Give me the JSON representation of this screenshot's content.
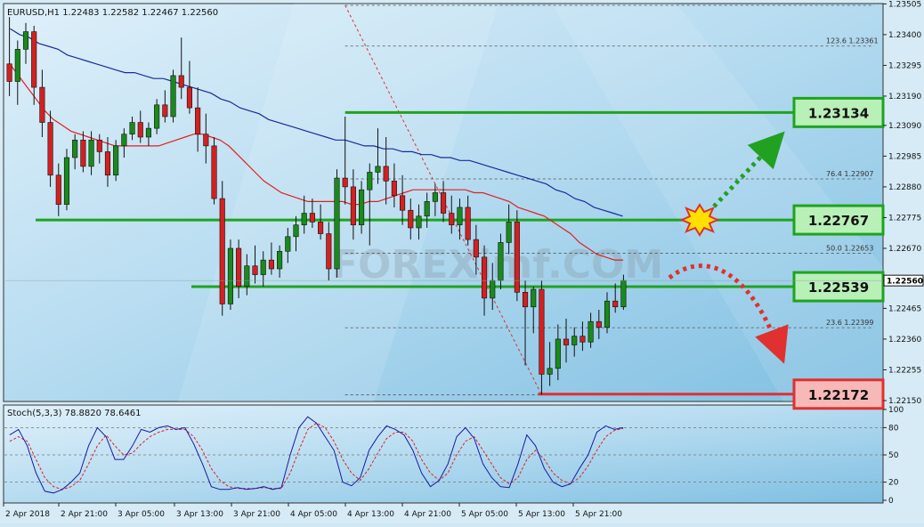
{
  "header": {
    "symbol_info": "EURUSD,H1  1.22483 1.22582 1.22467 1.22560",
    "stoch_info": "Stoch(5,3,3) 78.8820 78.6461"
  },
  "watermark": "FOREXimf.COM",
  "colors": {
    "up_candle": "#1a8a1a",
    "down_candle": "#d42020",
    "ma_fast": "#e02020",
    "ma_slow": "#1a2a9a",
    "level_line": "#1fa31f",
    "level_box_green": "#b8f0b8",
    "level_box_red": "#f7b8b8",
    "stoch_main": "#1a1aa0",
    "stoch_signal": "#e02020"
  },
  "chart_data": {
    "type": "candlestick",
    "symbol": "EURUSD",
    "timeframe": "H1",
    "ylim": [
      1.2215,
      1.235
    ],
    "y_ticks": [
      "1.23505",
      "1.23400",
      "1.23295",
      "1.23190",
      "1.23090",
      "1.22985",
      "1.22880",
      "1.22775",
      "1.22670",
      "1.22560",
      "1.22465",
      "1.22360",
      "1.22255",
      "1.22150"
    ],
    "current_price": "1.22560",
    "x_ticks": [
      "2 Apr 2018",
      "2 Apr 21:00",
      "3 Apr 05:00",
      "3 Apr 13:00",
      "3 Apr 21:00",
      "4 Apr 05:00",
      "4 Apr 13:00",
      "4 Apr 21:00",
      "5 Apr 05:00",
      "5 Apr 13:00",
      "5 Apr 21:00"
    ],
    "candles": [
      [
        1.233,
        1.2346,
        1.2319,
        1.2324
      ],
      [
        1.2324,
        1.2338,
        1.2316,
        1.2335
      ],
      [
        1.2335,
        1.2344,
        1.233,
        1.2341
      ],
      [
        1.2341,
        1.2343,
        1.2316,
        1.2322
      ],
      [
        1.2322,
        1.2328,
        1.2305,
        1.231
      ],
      [
        1.231,
        1.2314,
        1.2288,
        1.2292
      ],
      [
        1.2292,
        1.2296,
        1.2278,
        1.2282
      ],
      [
        1.2282,
        1.2301,
        1.228,
        1.2298
      ],
      [
        1.2298,
        1.2306,
        1.2294,
        1.2304
      ],
      [
        1.2304,
        1.2307,
        1.2293,
        1.2295
      ],
      [
        1.2295,
        1.2307,
        1.2292,
        1.2304
      ],
      [
        1.2304,
        1.2306,
        1.2296,
        1.23
      ],
      [
        1.23,
        1.2305,
        1.2288,
        1.2292
      ],
      [
        1.2292,
        1.2304,
        1.229,
        1.2302
      ],
      [
        1.2302,
        1.2308,
        1.2298,
        1.2306
      ],
      [
        1.2306,
        1.2312,
        1.2304,
        1.231
      ],
      [
        1.231,
        1.2314,
        1.2303,
        1.2305
      ],
      [
        1.2305,
        1.231,
        1.2302,
        1.2308
      ],
      [
        1.2308,
        1.2318,
        1.2306,
        1.2316
      ],
      [
        1.2316,
        1.2321,
        1.231,
        1.2312
      ],
      [
        1.2312,
        1.2328,
        1.231,
        1.2326
      ],
      [
        1.2326,
        1.2339,
        1.2318,
        1.2322
      ],
      [
        1.2322,
        1.2331,
        1.2313,
        1.2315
      ],
      [
        1.2315,
        1.2322,
        1.23,
        1.2306
      ],
      [
        1.2306,
        1.2313,
        1.2296,
        1.2302
      ],
      [
        1.2302,
        1.2305,
        1.2282,
        1.2284
      ],
      [
        1.2284,
        1.229,
        1.2244,
        1.2248
      ],
      [
        1.2248,
        1.227,
        1.2246,
        1.2267
      ],
      [
        1.2267,
        1.227,
        1.225,
        1.2254
      ],
      [
        1.2254,
        1.2265,
        1.2251,
        1.2261
      ],
      [
        1.2261,
        1.2268,
        1.2255,
        1.2258
      ],
      [
        1.2258,
        1.2266,
        1.2254,
        1.2263
      ],
      [
        1.2263,
        1.2269,
        1.2258,
        1.226
      ],
      [
        1.226,
        1.2268,
        1.2257,
        1.2266
      ],
      [
        1.2266,
        1.2274,
        1.2262,
        1.2271
      ],
      [
        1.2271,
        1.2278,
        1.2266,
        1.2275
      ],
      [
        1.2275,
        1.2285,
        1.2272,
        1.2279
      ],
      [
        1.2279,
        1.2284,
        1.2274,
        1.2276
      ],
      [
        1.2276,
        1.2282,
        1.227,
        1.2272
      ],
      [
        1.2272,
        1.2276,
        1.2256,
        1.226
      ],
      [
        1.226,
        1.2294,
        1.2257,
        1.2291
      ],
      [
        1.2291,
        1.2312,
        1.2282,
        1.2288
      ],
      [
        1.2288,
        1.2294,
        1.227,
        1.2275
      ],
      [
        1.2275,
        1.229,
        1.2272,
        1.2287
      ],
      [
        1.2287,
        1.2296,
        1.2268,
        1.2293
      ],
      [
        1.2293,
        1.2308,
        1.2289,
        1.2295
      ],
      [
        1.2295,
        1.2305,
        1.2282,
        1.229
      ],
      [
        1.229,
        1.2296,
        1.2281,
        1.2285
      ],
      [
        1.2285,
        1.2292,
        1.2275,
        1.228
      ],
      [
        1.228,
        1.2284,
        1.227,
        1.2274
      ],
      [
        1.2274,
        1.2282,
        1.227,
        1.2278
      ],
      [
        1.2278,
        1.2286,
        1.2274,
        1.2283
      ],
      [
        1.2283,
        1.2289,
        1.2278,
        1.2286
      ],
      [
        1.2286,
        1.229,
        1.2276,
        1.2279
      ],
      [
        1.2279,
        1.2285,
        1.2272,
        1.2275
      ],
      [
        1.2275,
        1.2284,
        1.227,
        1.2281
      ],
      [
        1.2281,
        1.2285,
        1.2268,
        1.227
      ],
      [
        1.227,
        1.2275,
        1.2258,
        1.2264
      ],
      [
        1.2264,
        1.2268,
        1.2244,
        1.225
      ],
      [
        1.225,
        1.2262,
        1.2246,
        1.2256
      ],
      [
        1.2256,
        1.2272,
        1.2253,
        1.2269
      ],
      [
        1.2269,
        1.2282,
        1.2265,
        1.2276
      ],
      [
        1.2276,
        1.228,
        1.2249,
        1.2252
      ],
      [
        1.2252,
        1.2256,
        1.2227,
        1.2247
      ],
      [
        1.2247,
        1.2254,
        1.2238,
        1.2253
      ],
      [
        1.2253,
        1.2256,
        1.2217,
        1.2224
      ],
      [
        1.2224,
        1.2235,
        1.222,
        1.2226
      ],
      [
        1.2226,
        1.2241,
        1.2222,
        1.2236
      ],
      [
        1.2236,
        1.2243,
        1.2228,
        1.2234
      ],
      [
        1.2234,
        1.224,
        1.223,
        1.2237
      ],
      [
        1.2237,
        1.2242,
        1.2232,
        1.2235
      ],
      [
        1.2235,
        1.2245,
        1.2233,
        1.2242
      ],
      [
        1.2242,
        1.2246,
        1.2236,
        1.224
      ],
      [
        1.224,
        1.2252,
        1.2238,
        1.2249
      ],
      [
        1.2249,
        1.2255,
        1.2245,
        1.2247
      ],
      [
        1.2247,
        1.2258,
        1.2246,
        1.2256
      ]
    ],
    "ma_fast": [
      1.233,
      1.2326,
      1.2322,
      1.2318,
      1.2314,
      1.2311,
      1.2309,
      1.2307,
      1.2306,
      1.2305,
      1.2304,
      1.2303,
      1.2302,
      1.2302,
      1.2302,
      1.2302,
      1.2302,
      1.2302,
      1.2303,
      1.2304,
      1.2305,
      1.2306,
      1.2306,
      1.2305,
      1.2304,
      1.2302,
      1.2299,
      1.2296,
      1.2293,
      1.229,
      1.2288,
      1.2286,
      1.2285,
      1.2284,
      1.2283,
      1.2283,
      1.2283,
      1.2283,
      1.2283,
      1.2282,
      1.2282,
      1.2283,
      1.2283,
      1.2284,
      1.2285,
      1.2286,
      1.2287,
      1.2287,
      1.2287,
      1.2287,
      1.2287,
      1.2287,
      1.2287,
      1.2286,
      1.2286,
      1.2285,
      1.2284,
      1.2283,
      1.2281,
      1.228,
      1.2279,
      1.2278,
      1.2276,
      1.2274,
      1.2272,
      1.2269,
      1.2267,
      1.2265,
      1.2264,
      1.2263,
      1.2263
    ],
    "ma_slow": [
      1.2342,
      1.234,
      1.2339,
      1.2337,
      1.2336,
      1.2335,
      1.2333,
      1.2332,
      1.2331,
      1.233,
      1.2329,
      1.2328,
      1.2327,
      1.2327,
      1.2326,
      1.2325,
      1.2325,
      1.2324,
      1.2323,
      1.2322,
      1.2321,
      1.232,
      1.2318,
      1.2317,
      1.2315,
      1.2314,
      1.2313,
      1.2311,
      1.231,
      1.2309,
      1.2308,
      1.2307,
      1.2306,
      1.2305,
      1.2304,
      1.2304,
      1.2303,
      1.2302,
      1.2302,
      1.2301,
      1.2301,
      1.23,
      1.23,
      1.2299,
      1.2299,
      1.2298,
      1.2298,
      1.2297,
      1.2297,
      1.2296,
      1.2295,
      1.2294,
      1.2293,
      1.2292,
      1.2291,
      1.229,
      1.2289,
      1.2287,
      1.2286,
      1.2284,
      1.2283,
      1.2281,
      1.228,
      1.2279,
      1.2278
    ],
    "fib_levels": [
      {
        "label": "123.6",
        "value": "1.23361",
        "price": 1.23361
      },
      {
        "label": "76.4",
        "value": "1.22907",
        "price": 1.22907
      },
      {
        "label": "50.0",
        "value": "1.22653",
        "price": 1.22653
      },
      {
        "label": "23.6",
        "value": "1.22399",
        "price": 1.22399
      }
    ],
    "fib_top_price": 1.235,
    "fib_bottom_price": 1.2217,
    "levels": [
      {
        "label": "1.23134",
        "price": 1.23134,
        "kind": "resistance"
      },
      {
        "label": "1.22767",
        "price": 1.22767,
        "kind": "resistance"
      },
      {
        "label": "1.22539",
        "price": 1.22539,
        "kind": "support"
      },
      {
        "label": "1.22172",
        "price": 1.22172,
        "kind": "support"
      }
    ],
    "stochastic": {
      "ylim": [
        0,
        100
      ],
      "y_ticks": [
        "100",
        "80",
        "50",
        "20",
        "0"
      ],
      "main": [
        72,
        78,
        60,
        30,
        10,
        8,
        12,
        20,
        30,
        60,
        80,
        70,
        45,
        45,
        60,
        78,
        75,
        80,
        82,
        78,
        80,
        62,
        40,
        15,
        12,
        12,
        14,
        12,
        13,
        15,
        12,
        14,
        50,
        80,
        92,
        85,
        70,
        55,
        20,
        16,
        25,
        55,
        70,
        82,
        78,
        72,
        55,
        30,
        15,
        22,
        40,
        70,
        80,
        68,
        40,
        25,
        15,
        14,
        40,
        72,
        60,
        35,
        20,
        15,
        18,
        35,
        50,
        75,
        82,
        78,
        80
      ],
      "signal": [
        65,
        70,
        65,
        45,
        25,
        15,
        12,
        15,
        22,
        40,
        60,
        72,
        60,
        50,
        52,
        62,
        70,
        75,
        78,
        78,
        78,
        70,
        55,
        35,
        22,
        15,
        13,
        13,
        13,
        14,
        13,
        13,
        30,
        55,
        78,
        85,
        80,
        65,
        45,
        30,
        22,
        35,
        52,
        68,
        75,
        75,
        65,
        45,
        30,
        22,
        30,
        50,
        65,
        70,
        55,
        40,
        25,
        18,
        25,
        45,
        55,
        45,
        30,
        22,
        18,
        25,
        38,
        55,
        70,
        77,
        79
      ]
    }
  }
}
